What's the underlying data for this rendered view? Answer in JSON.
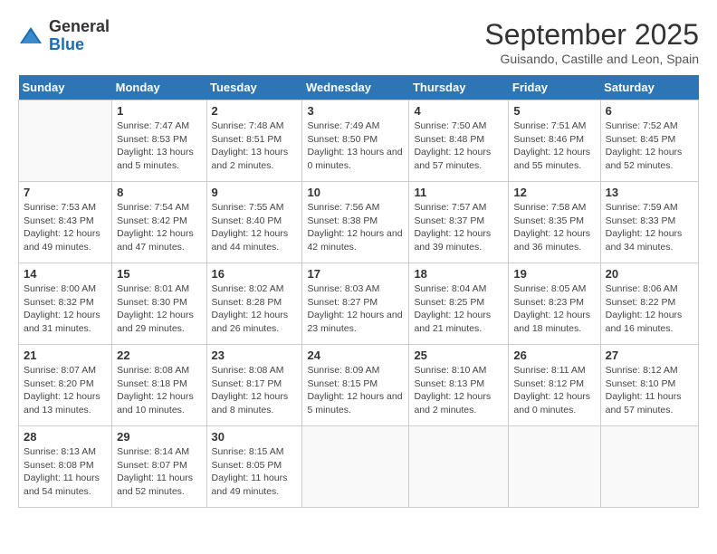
{
  "header": {
    "logo_general": "General",
    "logo_blue": "Blue",
    "month_title": "September 2025",
    "location": "Guisando, Castille and Leon, Spain"
  },
  "weekdays": [
    "Sunday",
    "Monday",
    "Tuesday",
    "Wednesday",
    "Thursday",
    "Friday",
    "Saturday"
  ],
  "weeks": [
    [
      {
        "day": "",
        "empty": true
      },
      {
        "day": "1",
        "sunrise": "7:47 AM",
        "sunset": "8:53 PM",
        "daylight": "13 hours and 5 minutes."
      },
      {
        "day": "2",
        "sunrise": "7:48 AM",
        "sunset": "8:51 PM",
        "daylight": "13 hours and 2 minutes."
      },
      {
        "day": "3",
        "sunrise": "7:49 AM",
        "sunset": "8:50 PM",
        "daylight": "13 hours and 0 minutes."
      },
      {
        "day": "4",
        "sunrise": "7:50 AM",
        "sunset": "8:48 PM",
        "daylight": "12 hours and 57 minutes."
      },
      {
        "day": "5",
        "sunrise": "7:51 AM",
        "sunset": "8:46 PM",
        "daylight": "12 hours and 55 minutes."
      },
      {
        "day": "6",
        "sunrise": "7:52 AM",
        "sunset": "8:45 PM",
        "daylight": "12 hours and 52 minutes."
      }
    ],
    [
      {
        "day": "7",
        "sunrise": "7:53 AM",
        "sunset": "8:43 PM",
        "daylight": "12 hours and 49 minutes."
      },
      {
        "day": "8",
        "sunrise": "7:54 AM",
        "sunset": "8:42 PM",
        "daylight": "12 hours and 47 minutes."
      },
      {
        "day": "9",
        "sunrise": "7:55 AM",
        "sunset": "8:40 PM",
        "daylight": "12 hours and 44 minutes."
      },
      {
        "day": "10",
        "sunrise": "7:56 AM",
        "sunset": "8:38 PM",
        "daylight": "12 hours and 42 minutes."
      },
      {
        "day": "11",
        "sunrise": "7:57 AM",
        "sunset": "8:37 PM",
        "daylight": "12 hours and 39 minutes."
      },
      {
        "day": "12",
        "sunrise": "7:58 AM",
        "sunset": "8:35 PM",
        "daylight": "12 hours and 36 minutes."
      },
      {
        "day": "13",
        "sunrise": "7:59 AM",
        "sunset": "8:33 PM",
        "daylight": "12 hours and 34 minutes."
      }
    ],
    [
      {
        "day": "14",
        "sunrise": "8:00 AM",
        "sunset": "8:32 PM",
        "daylight": "12 hours and 31 minutes."
      },
      {
        "day": "15",
        "sunrise": "8:01 AM",
        "sunset": "8:30 PM",
        "daylight": "12 hours and 29 minutes."
      },
      {
        "day": "16",
        "sunrise": "8:02 AM",
        "sunset": "8:28 PM",
        "daylight": "12 hours and 26 minutes."
      },
      {
        "day": "17",
        "sunrise": "8:03 AM",
        "sunset": "8:27 PM",
        "daylight": "12 hours and 23 minutes."
      },
      {
        "day": "18",
        "sunrise": "8:04 AM",
        "sunset": "8:25 PM",
        "daylight": "12 hours and 21 minutes."
      },
      {
        "day": "19",
        "sunrise": "8:05 AM",
        "sunset": "8:23 PM",
        "daylight": "12 hours and 18 minutes."
      },
      {
        "day": "20",
        "sunrise": "8:06 AM",
        "sunset": "8:22 PM",
        "daylight": "12 hours and 16 minutes."
      }
    ],
    [
      {
        "day": "21",
        "sunrise": "8:07 AM",
        "sunset": "8:20 PM",
        "daylight": "12 hours and 13 minutes."
      },
      {
        "day": "22",
        "sunrise": "8:08 AM",
        "sunset": "8:18 PM",
        "daylight": "12 hours and 10 minutes."
      },
      {
        "day": "23",
        "sunrise": "8:08 AM",
        "sunset": "8:17 PM",
        "daylight": "12 hours and 8 minutes."
      },
      {
        "day": "24",
        "sunrise": "8:09 AM",
        "sunset": "8:15 PM",
        "daylight": "12 hours and 5 minutes."
      },
      {
        "day": "25",
        "sunrise": "8:10 AM",
        "sunset": "8:13 PM",
        "daylight": "12 hours and 2 minutes."
      },
      {
        "day": "26",
        "sunrise": "8:11 AM",
        "sunset": "8:12 PM",
        "daylight": "12 hours and 0 minutes."
      },
      {
        "day": "27",
        "sunrise": "8:12 AM",
        "sunset": "8:10 PM",
        "daylight": "11 hours and 57 minutes."
      }
    ],
    [
      {
        "day": "28",
        "sunrise": "8:13 AM",
        "sunset": "8:08 PM",
        "daylight": "11 hours and 54 minutes."
      },
      {
        "day": "29",
        "sunrise": "8:14 AM",
        "sunset": "8:07 PM",
        "daylight": "11 hours and 52 minutes."
      },
      {
        "day": "30",
        "sunrise": "8:15 AM",
        "sunset": "8:05 PM",
        "daylight": "11 hours and 49 minutes."
      },
      {
        "day": "",
        "empty": true
      },
      {
        "day": "",
        "empty": true
      },
      {
        "day": "",
        "empty": true
      },
      {
        "day": "",
        "empty": true
      }
    ]
  ]
}
